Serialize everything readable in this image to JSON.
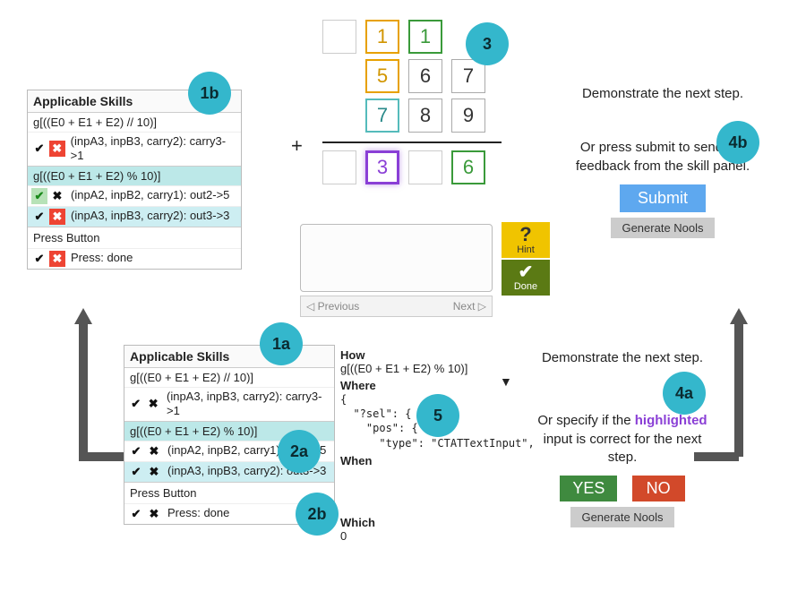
{
  "callouts": {
    "c1a": "1a",
    "c1b": "1b",
    "c2a": "2a",
    "c2b": "2b",
    "c3": "3",
    "c4a": "4a",
    "c4b": "4b",
    "c5": "5"
  },
  "skillpanel": {
    "title": "Applicable Skills",
    "header1": "g[((E0 + E1 + E2) // 10)]",
    "row1": "(inpA3, inpB3, carry2): carry3->1",
    "header2": "g[((E0 + E1 + E2) % 10)]",
    "row2": "(inpA2, inpB2, carry1): out2->5",
    "row3": "(inpA3, inpB3, carry2): out3->3",
    "pressbutton": "Press Button",
    "row4": "Press: done",
    "check": "✔",
    "xmark": "✖"
  },
  "addition": {
    "plus": "+",
    "r1": [
      "",
      "1",
      "1",
      ""
    ],
    "r2": [
      "",
      "5",
      "6",
      "7"
    ],
    "r3": [
      "",
      "7",
      "8",
      "9"
    ],
    "res": [
      "",
      "3",
      "",
      "6"
    ]
  },
  "hint": {
    "q": "?",
    "label": "Hint"
  },
  "done": {
    "check": "✔",
    "label": "Done"
  },
  "prevnext": {
    "prev": "◁  Previous",
    "next": "Next  ▷"
  },
  "howpanel": {
    "how": "How",
    "howexpr": "g[((E0 + E1 + E2) % 10)]",
    "where": "Where",
    "wherecode": "{\n  \"?sel\": {\n    \"pos\": {\n      \"type\": \"CTATTextInput\",",
    "when": "When",
    "which": "Which",
    "whichval": "0"
  },
  "instr_top": {
    "l1": "Demonstrate the next step.",
    "l2": "Or press submit to send the feedback from the skill panel.",
    "submit": "Submit",
    "gen": "Generate Nools"
  },
  "instr_bot": {
    "l1": "Demonstrate the next step.",
    "l2a": "Or specify if the ",
    "l2b": "highlighted",
    "l2c": " input is correct for the next step.",
    "yes": "YES",
    "no": "NO",
    "gen": "Generate Nools"
  }
}
